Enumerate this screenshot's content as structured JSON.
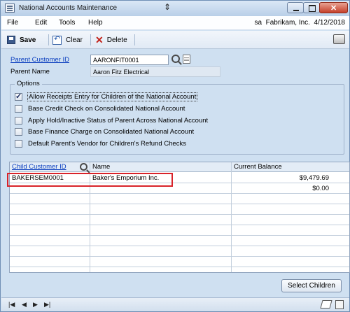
{
  "window": {
    "title": "National Accounts Maintenance"
  },
  "menu": {
    "items": [
      "File",
      "Edit",
      "Tools",
      "Help"
    ],
    "context": "sa  Fabrikam, Inc.  4/12/2018"
  },
  "toolbar": {
    "save_label": "Save",
    "clear_label": "Clear",
    "delete_label": "Delete"
  },
  "header": {
    "parent_id_label": "Parent Customer ID",
    "parent_id_value": "AARONFIT0001",
    "parent_name_label": "Parent Name",
    "parent_name_value": "Aaron Fitz Electrical"
  },
  "options": {
    "title": "Options",
    "items": [
      {
        "label": "Allow Receipts Entry for Children of the National Account",
        "checked": true
      },
      {
        "label": "Base Credit Check on Consolidated National Account",
        "checked": false
      },
      {
        "label": "Apply Hold/Inactive Status of Parent Across National Account",
        "checked": false
      },
      {
        "label": "Base Finance Charge on Consolidated National Account",
        "checked": false
      },
      {
        "label": "Default Parent's Vendor for Children's Refund Checks",
        "checked": false
      }
    ]
  },
  "grid": {
    "columns": [
      "Child Customer ID",
      "Name",
      "Current Balance"
    ],
    "rows": [
      {
        "id": "BAKERSEM0001",
        "name": "Baker's Emporium Inc.",
        "balance": "$9,479.69"
      },
      {
        "id": "",
        "name": "",
        "balance": "$0.00"
      }
    ]
  },
  "buttons": {
    "select_children": "Select Children"
  },
  "colors": {
    "highlight": "#d8232a",
    "link": "#0b3fbf",
    "window_bg": "#cfe0f1"
  }
}
